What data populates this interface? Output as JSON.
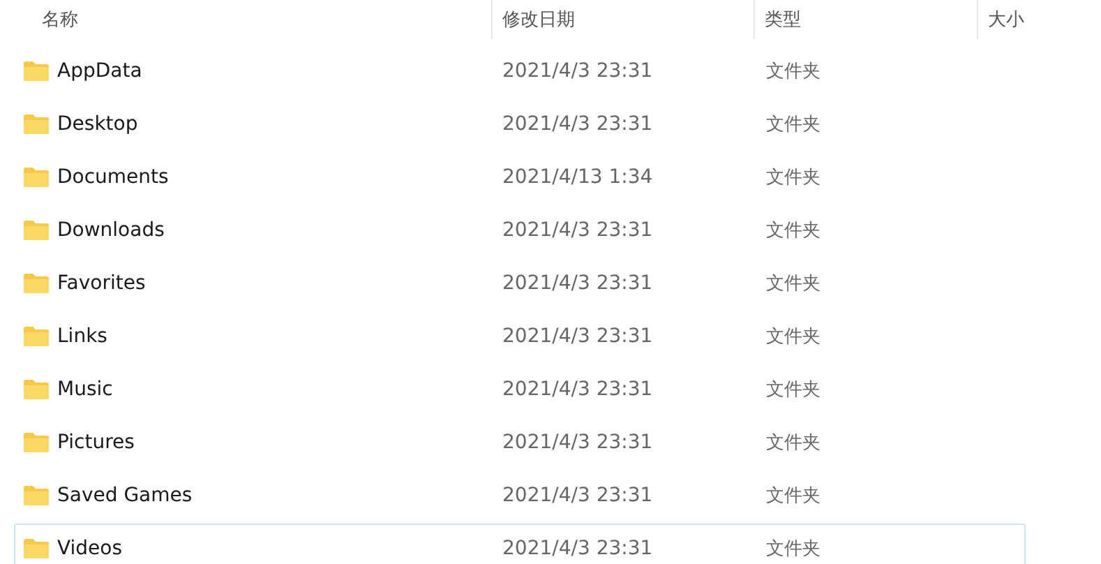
{
  "columns": [
    "名称",
    "修改日期",
    "类型",
    "大小"
  ],
  "rows": [
    {
      "name": "AppData",
      "modified": "2021/4/3 23:31",
      "type": "文件夹",
      "focused": false
    },
    {
      "name": "Desktop",
      "modified": "2021/4/3 23:31",
      "type": "文件夹",
      "focused": false
    },
    {
      "name": "Documents",
      "modified": "2021/4/13 1:34",
      "type": "文件夹",
      "focused": false
    },
    {
      "name": "Downloads",
      "modified": "2021/4/3 23:31",
      "type": "文件夹",
      "focused": false
    },
    {
      "name": "Favorites",
      "modified": "2021/4/3 23:31",
      "type": "文件夹",
      "focused": false
    },
    {
      "name": "Links",
      "modified": "2021/4/3 23:31",
      "type": "文件夹",
      "focused": false
    },
    {
      "name": "Music",
      "modified": "2021/4/3 23:31",
      "type": "文件夹",
      "focused": false
    },
    {
      "name": "Pictures",
      "modified": "2021/4/3 23:31",
      "type": "文件夹",
      "focused": false
    },
    {
      "name": "Saved Games",
      "modified": "2021/4/3 23:31",
      "type": "文件夹",
      "focused": false
    },
    {
      "name": "Videos",
      "modified": "2021/4/3 23:31",
      "type": "文件夹",
      "focused": true
    }
  ]
}
